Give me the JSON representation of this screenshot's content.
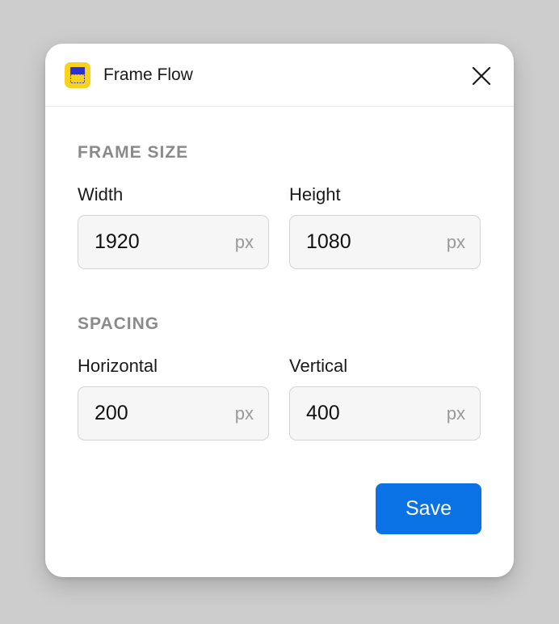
{
  "window": {
    "title": "Frame Flow",
    "icon": "frame-flow-app-icon",
    "close_icon": "close-icon"
  },
  "frame_size": {
    "heading": "FRAME SIZE",
    "width": {
      "label": "Width",
      "value": "1920",
      "unit": "px"
    },
    "height": {
      "label": "Height",
      "value": "1080",
      "unit": "px"
    }
  },
  "spacing": {
    "heading": "SPACING",
    "horizontal": {
      "label": "Horizontal",
      "value": "200",
      "unit": "px"
    },
    "vertical": {
      "label": "Vertical",
      "value": "400",
      "unit": "px"
    }
  },
  "actions": {
    "save_label": "Save"
  },
  "colors": {
    "accent": "#0b72e5",
    "icon_yellow": "#f7d31e",
    "icon_blue": "#2b2fd6"
  }
}
